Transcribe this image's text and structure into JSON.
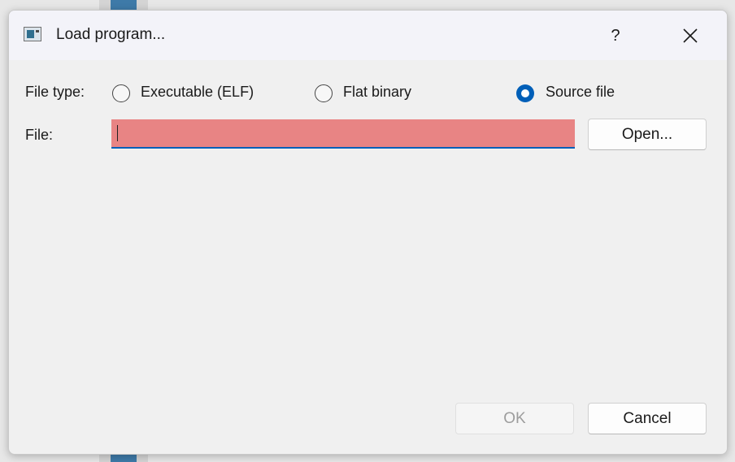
{
  "dialog": {
    "title": "Load program...",
    "help_label": "?",
    "file_type_label": "File type:",
    "file_label": "File:",
    "file_value": "",
    "radio_options": [
      {
        "label": "Executable (ELF)",
        "checked": false
      },
      {
        "label": "Flat binary",
        "checked": false
      },
      {
        "label": "Source file",
        "checked": true
      }
    ],
    "open_button": "Open...",
    "ok_button": "OK",
    "cancel_button": "Cancel"
  },
  "colors": {
    "accent": "#005fb8",
    "file_input_error_bg": "#e88484",
    "dialog_bg": "#f0f0f0"
  },
  "icons": [
    "app-icon",
    "help-icon",
    "close-icon"
  ]
}
